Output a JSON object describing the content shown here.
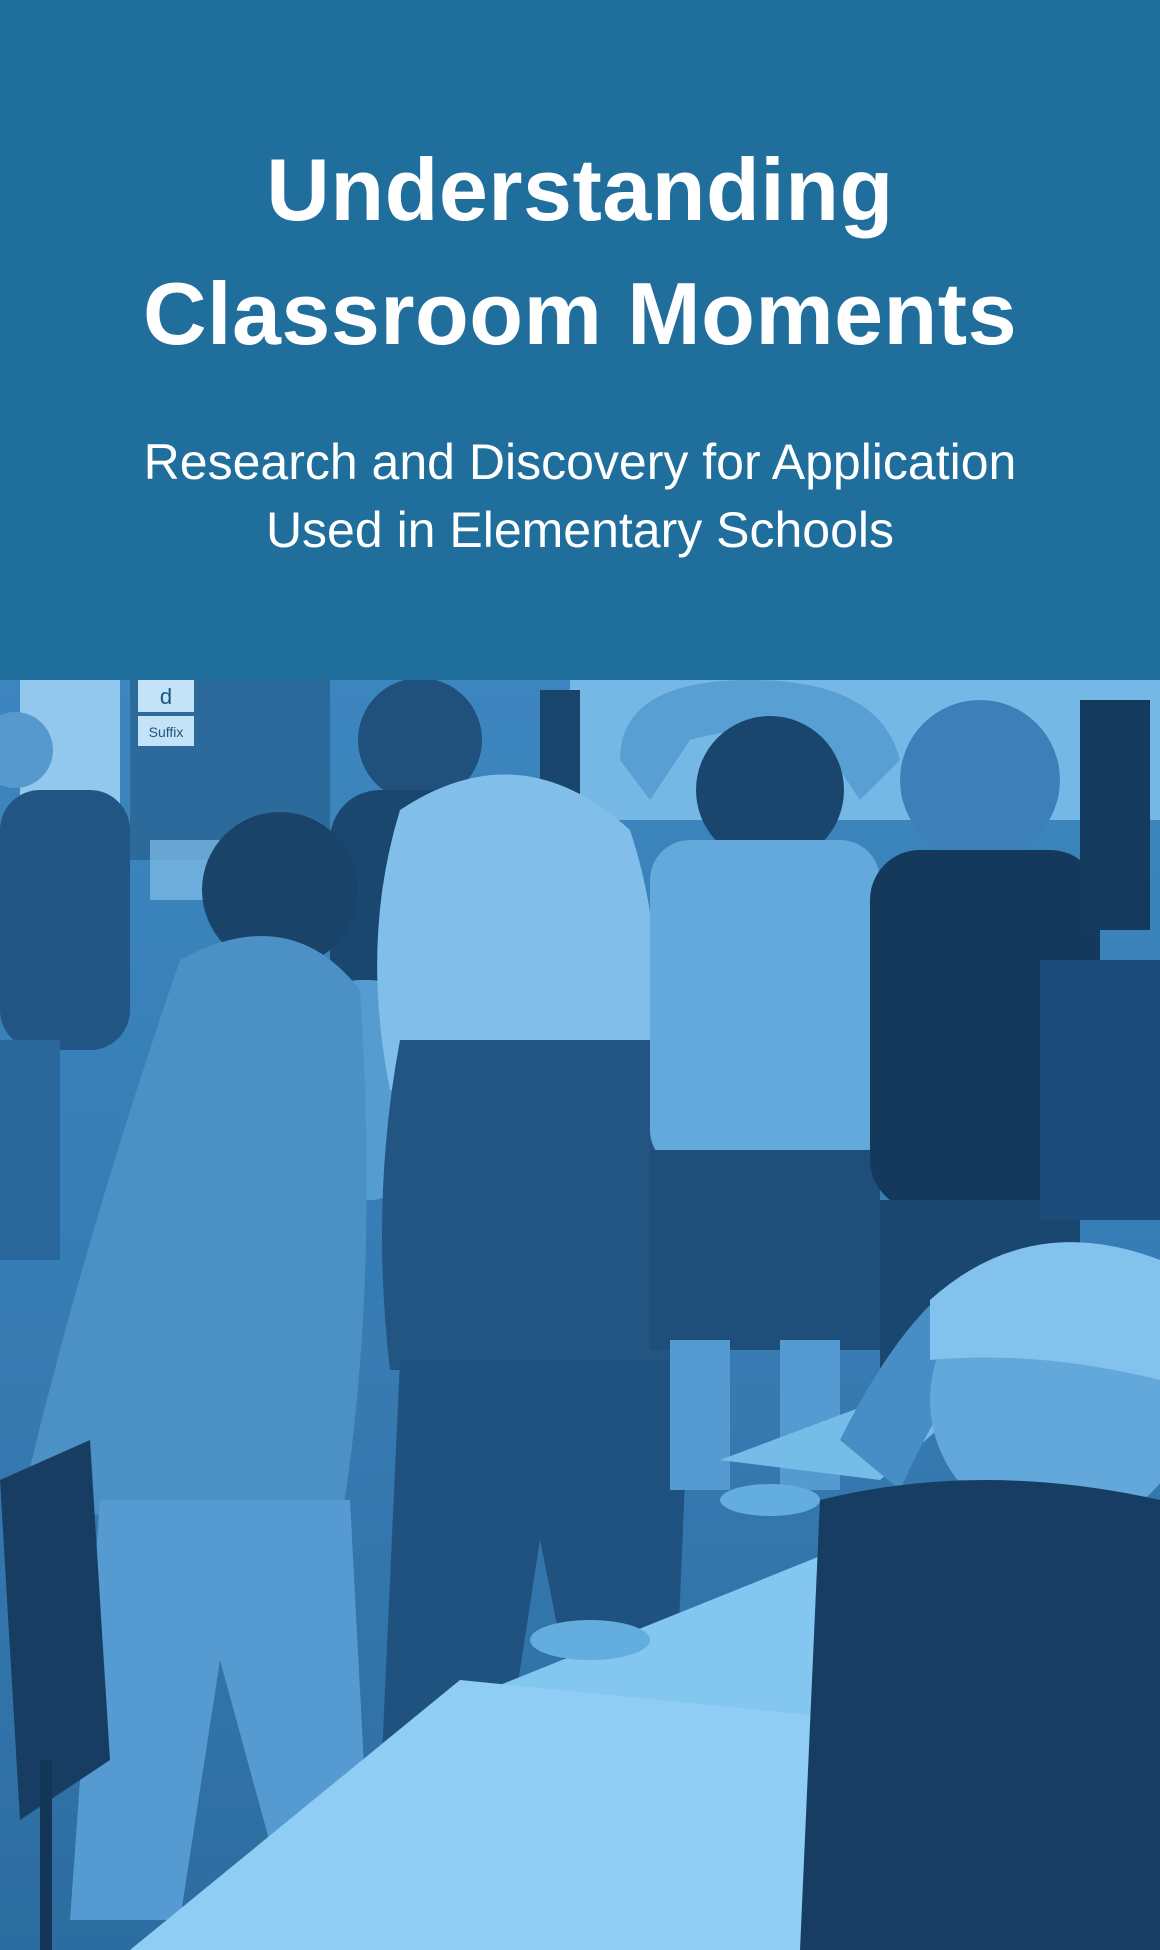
{
  "hero": {
    "title_line1": "Understanding",
    "title_line2": "Classroom Moments",
    "subtitle_line1": "Research and Discovery for Application",
    "subtitle_line2": "Used in Elementary Schools"
  },
  "photo": {
    "sign_letter": "d",
    "sign_label": "Suffix"
  },
  "colors": {
    "header_background": "#206e9c",
    "text": "#ffffff",
    "photo_tint": "#4a8fc6"
  }
}
